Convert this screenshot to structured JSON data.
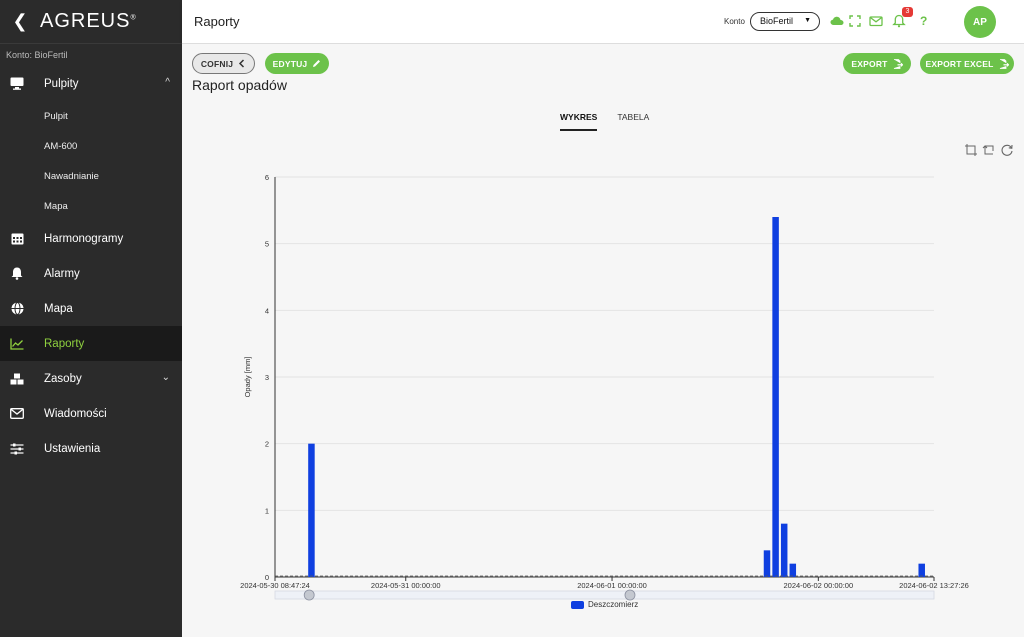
{
  "app": {
    "logo": "AGREUS",
    "account_label": "Konto: BioFertil"
  },
  "sidebar": {
    "items": [
      {
        "label": "Pulpity",
        "icon": "monitor-icon",
        "expanded": true
      },
      {
        "label": "Pulpit",
        "sub": true
      },
      {
        "label": "AM-600",
        "sub": true
      },
      {
        "label": "Nawadnianie",
        "sub": true
      },
      {
        "label": "Mapa",
        "sub": true
      },
      {
        "label": "Harmonogramy",
        "icon": "calendar-icon"
      },
      {
        "label": "Alarmy",
        "icon": "bell-icon"
      },
      {
        "label": "Mapa",
        "icon": "globe-icon"
      },
      {
        "label": "Raporty",
        "icon": "chart-line-icon",
        "active": true
      },
      {
        "label": "Zasoby",
        "icon": "boxes-icon"
      },
      {
        "label": "Wiadomości",
        "icon": "mail-icon"
      },
      {
        "label": "Ustawienia",
        "icon": "sliders-icon"
      }
    ]
  },
  "header": {
    "title": "Raporty",
    "konto_label": "Konto",
    "konto_value": "BioFertil",
    "notifications_count": "3",
    "help": "?",
    "avatar": "AP"
  },
  "toolbar": {
    "back_label": "COFNIJ",
    "edit_label": "EDYTUJ",
    "export_label": "EXPORT",
    "export_excel_label": "EXPORT EXCEL"
  },
  "page": {
    "title": "Raport opadów",
    "tabs": [
      {
        "label": "WYKRES",
        "active": true
      },
      {
        "label": "TABELA",
        "active": false
      }
    ]
  },
  "colors": {
    "accent": "#6cc24a",
    "sidebar_bg": "#2b2b2b",
    "active_nav": "#8fd13f",
    "bar": "#0f3fe0",
    "badge": "#e53935"
  },
  "chart_data": {
    "type": "bar",
    "ylabel": "Opady [mm]",
    "ylim": [
      0,
      6
    ],
    "yticks": [
      0,
      1,
      2,
      3,
      4,
      5,
      6
    ],
    "xlim": [
      "2024-05-30 08:47:24",
      "2024-06-02 13:27:26"
    ],
    "xticks": [
      "2024-05-30 08:47:24",
      "2024-05-31 00:00:00",
      "2024-06-01 00:00:00",
      "2024-06-02 00:00:00",
      "2024-06-02 13:27:26"
    ],
    "grid": true,
    "legend_position": "bottom",
    "series": [
      {
        "name": "Deszczomierz",
        "points": [
          {
            "x": "2024-05-30 13:00",
            "y": 2.0
          },
          {
            "x": "2024-06-01 18:00",
            "y": 0.4
          },
          {
            "x": "2024-06-01 19:00",
            "y": 5.4
          },
          {
            "x": "2024-06-01 20:00",
            "y": 0.8
          },
          {
            "x": "2024-06-01 21:00",
            "y": 0.2
          },
          {
            "x": "2024-06-02 12:00",
            "y": 0.2
          }
        ]
      }
    ]
  }
}
